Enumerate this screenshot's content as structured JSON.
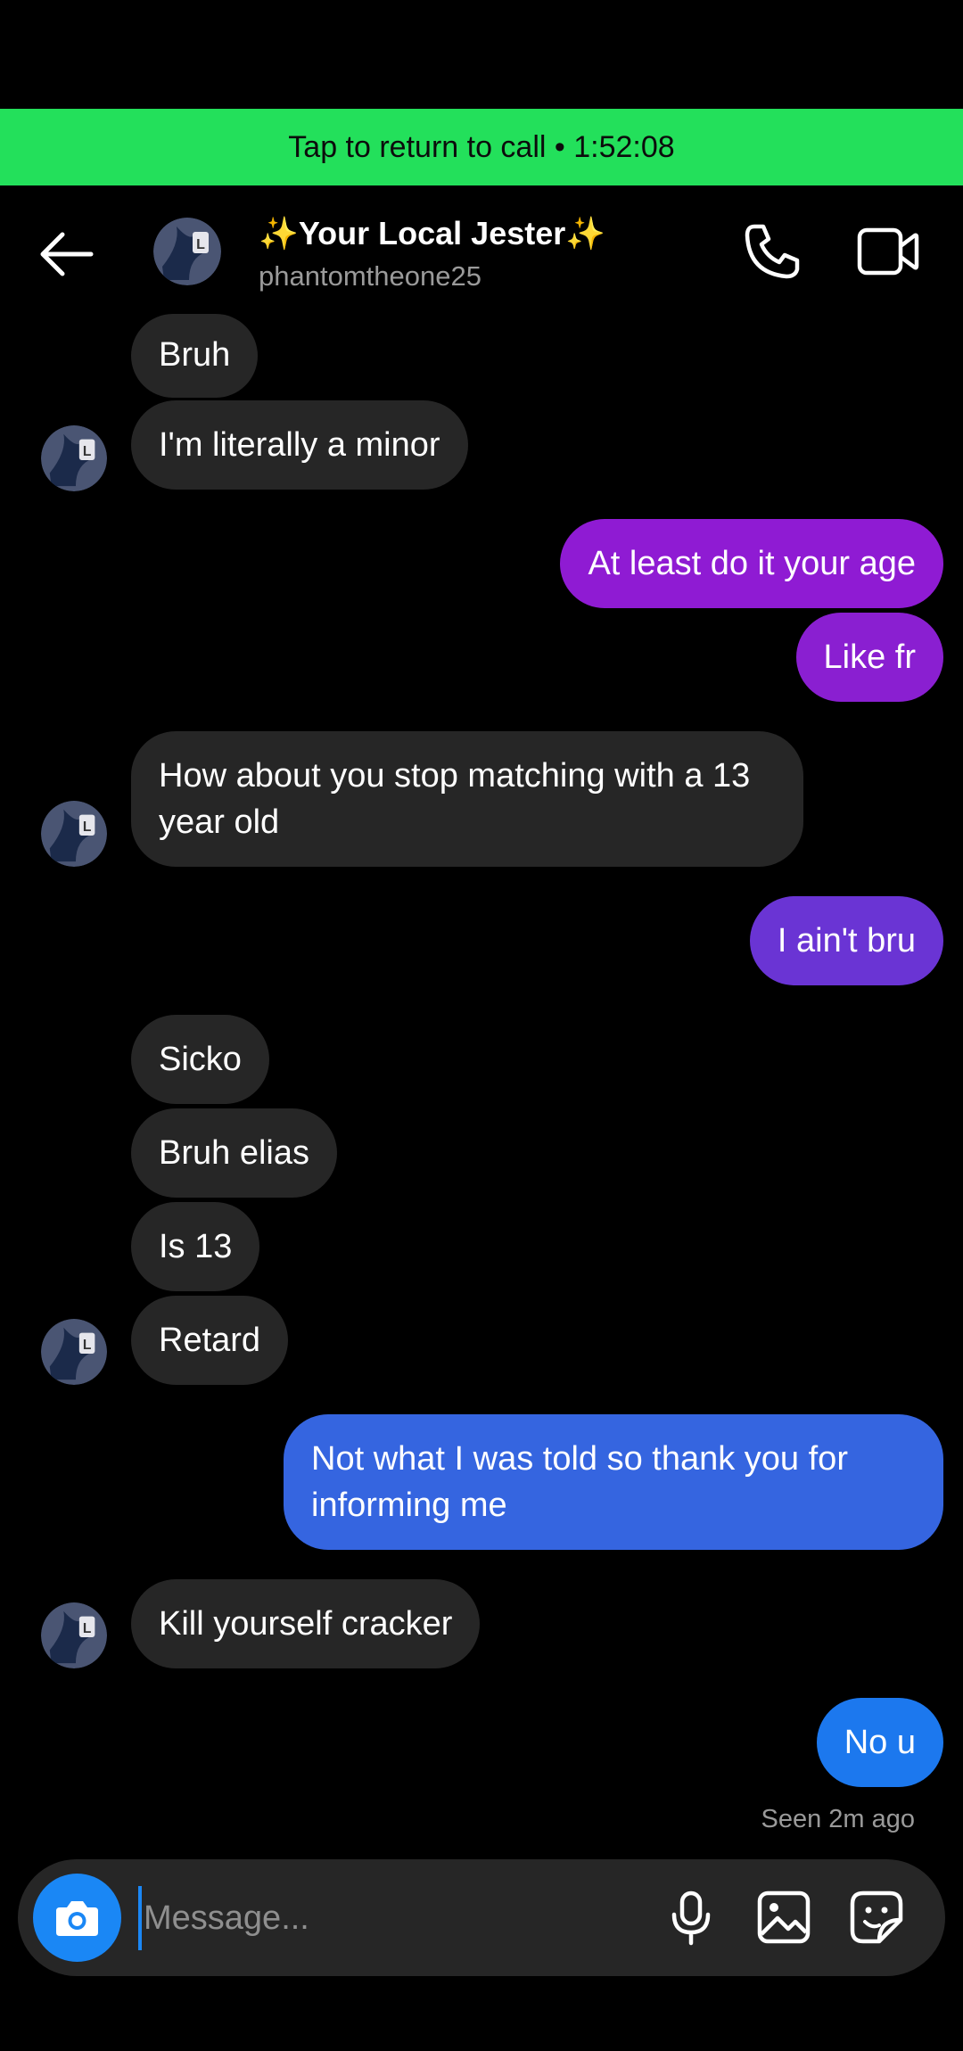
{
  "call_banner": {
    "text": "Tap to return to call • 1:52:08"
  },
  "header": {
    "name": "✨Your Local Jester✨",
    "username": "phantomtheone25",
    "icons": {
      "back": "back-arrow-icon",
      "call": "phone-icon",
      "video": "video-camera-icon"
    }
  },
  "messages": [
    {
      "side": "in",
      "text": "Bruh"
    },
    {
      "side": "in",
      "text": "I'm literally a minor"
    },
    {
      "side": "out",
      "text": "At least do it your age",
      "color": "#8f1bd3"
    },
    {
      "side": "out",
      "text": "Like fr",
      "color": "#8a1fd1"
    },
    {
      "side": "in",
      "text": "How about you stop matching with a 13 year old"
    },
    {
      "side": "out",
      "text": "I ain't bru",
      "color": "#6a34d4"
    },
    {
      "side": "in",
      "text": "Sicko"
    },
    {
      "side": "in",
      "text": "Bruh elias"
    },
    {
      "side": "in",
      "text": "Is 13"
    },
    {
      "side": "in",
      "text": "Retard"
    },
    {
      "side": "out",
      "text": "Not what I was told so thank you for informing me",
      "color": "#3565e0"
    },
    {
      "side": "in",
      "text": "Kill yourself cracker"
    },
    {
      "side": "out",
      "text": "No u",
      "color": "#1c78ee"
    }
  ],
  "seen_status": "Seen 2m ago",
  "composer": {
    "placeholder": "Message...",
    "icons": {
      "camera": "camera-icon",
      "mic": "microphone-icon",
      "gallery": "gallery-icon",
      "sticker": "sticker-icon"
    },
    "camera_color": "#1a87f5"
  }
}
